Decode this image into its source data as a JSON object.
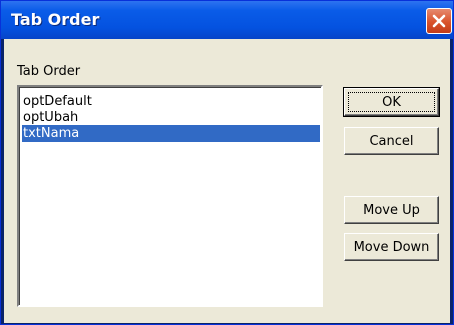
{
  "window": {
    "title": "Tab Order"
  },
  "dialog": {
    "group_label": "Tab Order",
    "items": [
      "optDefault",
      "optUbah",
      "txtNama"
    ],
    "selected_index": 2,
    "buttons": {
      "ok": "OK",
      "cancel": "Cancel",
      "move_up": "Move Up",
      "move_down": "Move Down"
    }
  },
  "icons": {
    "close": "close-icon"
  },
  "colors": {
    "selection": "#316ac5",
    "titlebar": "#0452e0"
  }
}
